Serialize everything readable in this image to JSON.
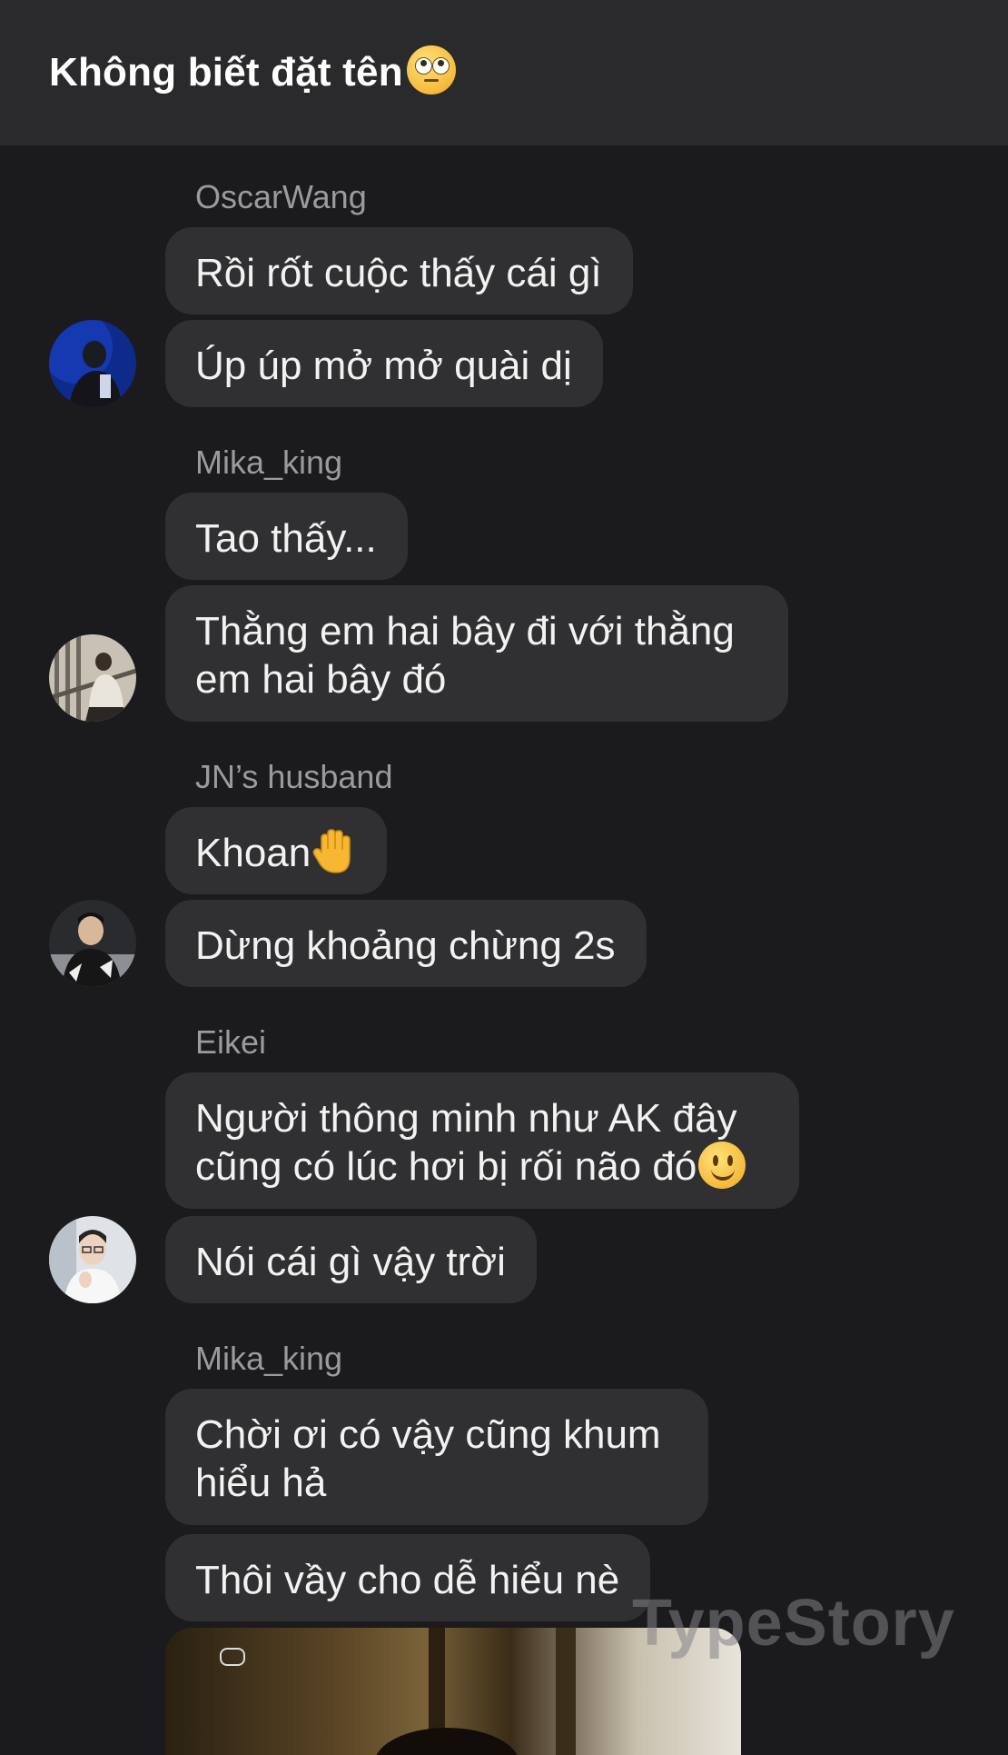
{
  "header": {
    "title": "Không biết đặt tên",
    "title_emoji": "face-with-rolling-eyes"
  },
  "messages": [
    {
      "sender": "OscarWang",
      "bubbles": [
        "Rồi rốt cuộc thấy cái gì",
        "Úp úp mở mở quài dị"
      ]
    },
    {
      "sender": "Mika_king",
      "bubbles": [
        "Tao thấy...",
        "Thằng em hai bây đi với thằng",
        "em hai bây đó"
      ]
    },
    {
      "sender": "JN’s husband",
      "bubbles": [
        "Khoan",
        "Dừng khoảng chừng 2s"
      ]
    },
    {
      "sender": "Eikei",
      "bubbles": [
        "Người thông minh như AK đây",
        "cũng có lúc hơi bị rối não đó",
        "Nói cái gì vậy trời"
      ]
    },
    {
      "sender": "Mika_king",
      "bubbles": [
        "Chời ơi có vậy cũng khum",
        "hiểu hả",
        "Thôi vầy cho dễ hiểu nè"
      ]
    }
  ],
  "watermark": "TypeStory"
}
